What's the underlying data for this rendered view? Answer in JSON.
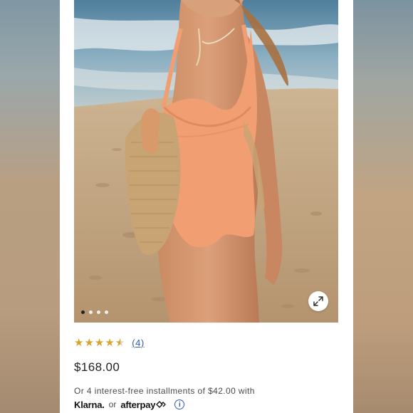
{
  "product": {
    "rating": 4.5,
    "review_count": "(4)",
    "price": "$168.00",
    "installments_text": "Or 4 interest-free installments of $42.00 with",
    "payment": {
      "klarna": "Klarna.",
      "or": "or",
      "afterpay": "afterpay"
    }
  },
  "gallery": {
    "image_count": 4,
    "active_index": 0,
    "expand_icon": "expand-arrows-icon"
  },
  "colors": {
    "star": "#d7a52a",
    "link": "#2f5bb7",
    "swimsuit": "#f29e73"
  }
}
